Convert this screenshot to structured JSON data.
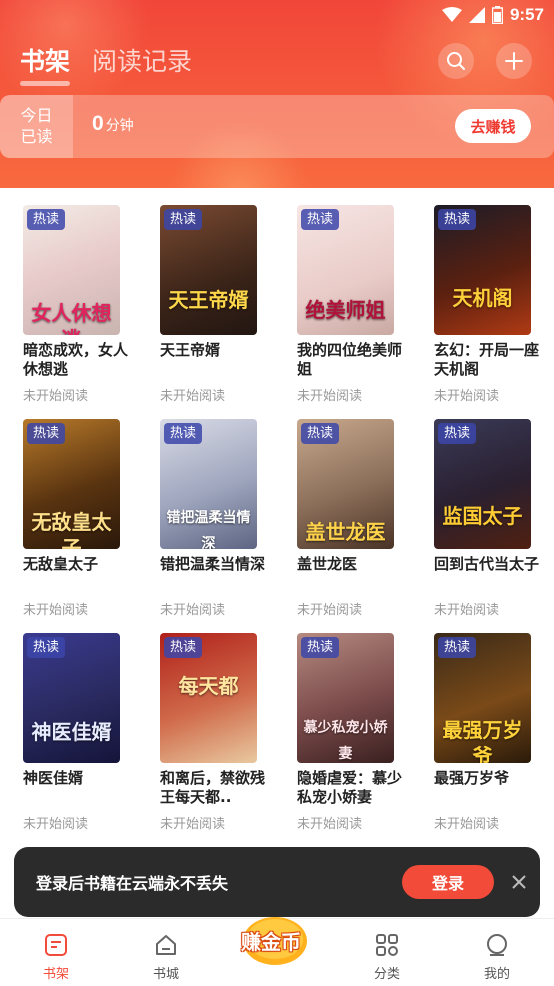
{
  "status_bar": {
    "time": "9:57"
  },
  "top_tabs": {
    "active": "书架",
    "inactive": "阅读记录"
  },
  "reading_card": {
    "today_line1": "今日",
    "today_line2": "已读",
    "minutes_value": "0",
    "minutes_unit": "分钟",
    "earn_button": "去赚钱"
  },
  "hot_tag": "热读",
  "books": [
    {
      "title": "暗恋成欢，女人休想逃",
      "status": "未开始阅读",
      "cover_text": "女人休想逃"
    },
    {
      "title": "天王帝婿",
      "status": "未开始阅读",
      "cover_text": "天王帝婿"
    },
    {
      "title": "我的四位绝美师姐",
      "status": "未开始阅读",
      "cover_text": "绝美师姐"
    },
    {
      "title": "玄幻：开局一座天机阁",
      "status": "未开始阅读",
      "cover_text": "天机阁"
    },
    {
      "title": "无敌皇太子",
      "status": "未开始阅读",
      "cover_text": "无敌皇太子"
    },
    {
      "title": "错把温柔当情深",
      "status": "未开始阅读",
      "cover_text": "错把温柔当情深"
    },
    {
      "title": "盖世龙医",
      "status": "未开始阅读",
      "cover_text": "盖世龙医"
    },
    {
      "title": "回到古代当太子",
      "status": "未开始阅读",
      "cover_text": "监国太子"
    },
    {
      "title": "神医佳婿",
      "status": "未开始阅读",
      "cover_text": "神医佳婿"
    },
    {
      "title": "和离后，禁欲残王每天都..",
      "status": "未开始阅读",
      "cover_text": "每天都"
    },
    {
      "title": "隐婚虐爱：慕少私宠小娇妻",
      "status": "未开始阅读",
      "cover_text": "慕少私宠小娇妻"
    },
    {
      "title": "最强万岁爷",
      "status": "未开始阅读",
      "cover_text": "最强万岁爷"
    }
  ],
  "login_banner": {
    "message": "登录后书籍在云端永不丢失",
    "login_button": "登录"
  },
  "bottom_nav": {
    "bookshelf": "书架",
    "bookstore": "书城",
    "earn_coins": "赚金币",
    "category": "分类",
    "mine": "我的"
  },
  "colors": {
    "accent": "#f24b39",
    "header_top": "#f1463a",
    "hot_tag": "#3c46aa"
  },
  "icons": [
    "search-icon",
    "plus-icon",
    "wifi-icon",
    "signal-icon",
    "battery-icon",
    "close-icon",
    "bookshelf-icon",
    "bookstore-icon",
    "coin-icon",
    "category-icon",
    "profile-icon"
  ]
}
